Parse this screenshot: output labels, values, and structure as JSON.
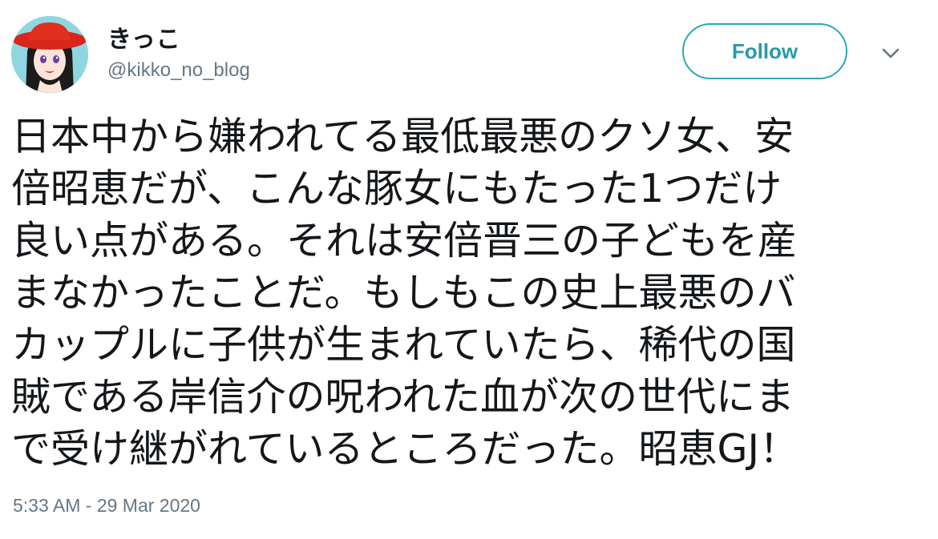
{
  "user": {
    "display_name": "きっこ",
    "handle": "@kikko_no_blog",
    "avatar_icon": "avatar-icon"
  },
  "actions": {
    "follow_label": "Follow",
    "menu_icon": "chevron-down-icon"
  },
  "tweet": {
    "lines": [
      "日本中から嫌われてる最低最悪のクソ女、安",
      "倍昭恵だが、こんな豚女にもたった1つだけ",
      "良い点がある。それは安倍晋三の子どもを産",
      "まなかったことだ。もしもこの史上最悪のバ",
      "カップルに子供が生まれていたら、稀代の国",
      "賊である岸信介の呪われた血が次の世代にま",
      "で受け継がれているところだった。昭恵GJ！"
    ],
    "timestamp": "5:33 AM - 29 Mar 2020"
  },
  "colors": {
    "follow_accent": "#2a9aa8",
    "secondary_text": "#657786",
    "primary_text": "#14171a"
  }
}
